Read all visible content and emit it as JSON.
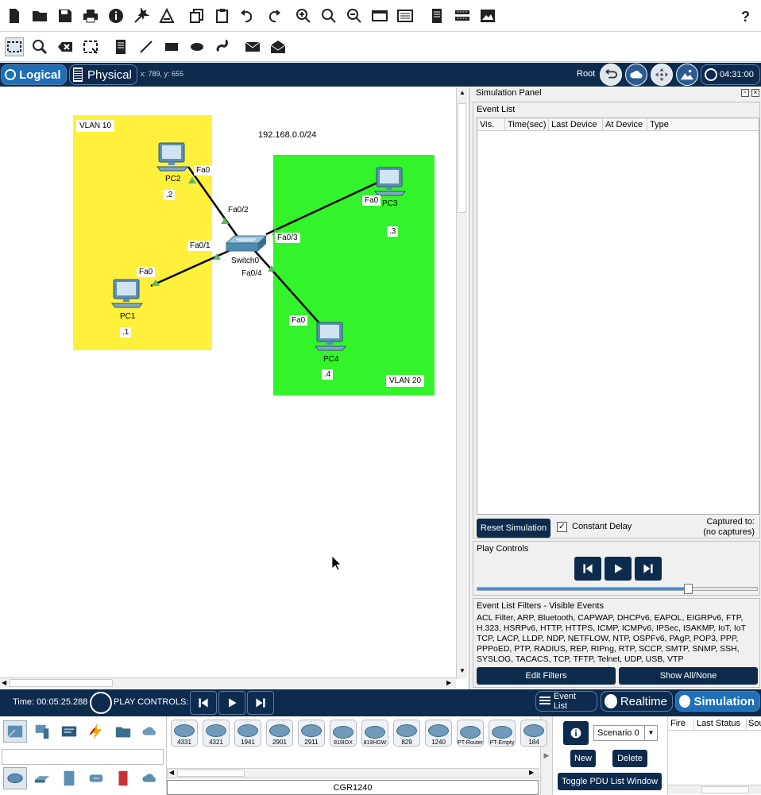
{
  "toolbar": {
    "top_icons": [
      "new-file-icon",
      "open-folder-icon",
      "save-icon",
      "print-icon",
      "info-icon",
      "activity-wizard-icon",
      "custom-device-icon",
      "copy-icon",
      "paste-icon",
      "undo-icon",
      "redo-icon",
      "zoom-in-icon",
      "zoom-reset-icon",
      "zoom-out-icon",
      "palette-icon",
      "custom-devices-dialog-icon",
      "notes-icon",
      "network-info-icon",
      "viewport-icon",
      "help-icon"
    ],
    "draw_icons": [
      "select-icon",
      "inspect-icon",
      "delete-icon",
      "resize-icon",
      "place-note-icon",
      "draw-line-icon",
      "draw-rectangle-icon",
      "draw-ellipse-icon",
      "freeform-icon",
      "simple-pdu-icon",
      "complex-pdu-icon"
    ]
  },
  "viewbar": {
    "logical_label": "Logical",
    "physical_label": "Physical",
    "coords": "x: 789, y: 655",
    "root_label": "Root",
    "clock": "04:31:00"
  },
  "topology": {
    "network_label": "192.168.0.0/24",
    "vlan10_label": "VLAN 10",
    "vlan20_label": "VLAN 20",
    "vlan10_color": "#fff03c",
    "vlan20_color": "#33f32a",
    "switch_label": "Switch0",
    "devices": {
      "pc1": {
        "name": "PC1",
        "ip": ".1",
        "port": "Fa0"
      },
      "pc2": {
        "name": "PC2",
        "ip": ".2",
        "port": "Fa0"
      },
      "pc3": {
        "name": "PC3",
        "ip": ".3",
        "port": "Fa0"
      },
      "pc4": {
        "name": "PC4",
        "ip": ".4",
        "port": "Fa0"
      }
    },
    "switch_ports": {
      "p1": "Fa0/1",
      "p2": "Fa0/2",
      "p3": "Fa0/3",
      "p4": "Fa0/4"
    },
    "link_end_color": "#5cb85c"
  },
  "simulation": {
    "panel_title": "Simulation Panel",
    "event_list_title": "Event List",
    "columns": [
      "Vis.",
      "Time(sec)",
      "Last Device",
      "At Device",
      "Type"
    ],
    "reset_label": "Reset Simulation",
    "constant_delay_label": "Constant Delay",
    "constant_delay_checked": true,
    "captured_label": "Captured to:",
    "captured_value": "(no captures)",
    "play_controls_title": "Play Controls",
    "speed_fraction": 0.75,
    "filters_title": "Event List Filters - Visible Events",
    "filters_text": "ACL Filter, ARP, Bluetooth, CAPWAP, DHCPv6, EAPOL, EIGRPv6, FTP, H.323, HSRPv6, HTTP, HTTPS, ICMP, ICMPv6, IPSec, ISAKMP, IoT, IoT TCP, LACP, LLDP, NDP, NETFLOW, NTP, OSPFv6, PAgP, POP3, PPP, PPPoED, PTP, RADIUS, REP, RIPng, RTP, SCCP, SMTP, SNMP, SSH, SYSLOG, TACACS, TCP, TFTP, Telnet, UDP, USB, VTP",
    "edit_filters_label": "Edit Filters",
    "show_all_label": "Show All/None"
  },
  "bottom": {
    "time_label": "Time: 00:05:25.288",
    "play_controls_label": "PLAY CONTROLS:",
    "event_list_label": "Event List",
    "realtime_label": "Realtime",
    "simulation_label": "Simulation",
    "devices": [
      "4331",
      "4321",
      "1941",
      "2901",
      "2911",
      "819IOX",
      "819HGW",
      "829",
      "1240",
      "PT-Router",
      "PT-Empty",
      "184"
    ],
    "selected_device": "CGR1240",
    "scenario_value": "Scenario 0",
    "new_label": "New",
    "delete_label": "Delete",
    "toggle_pdu_label": "Toggle PDU List Window",
    "pdu_columns": [
      "Fire",
      "Last Status",
      "Sou"
    ]
  }
}
